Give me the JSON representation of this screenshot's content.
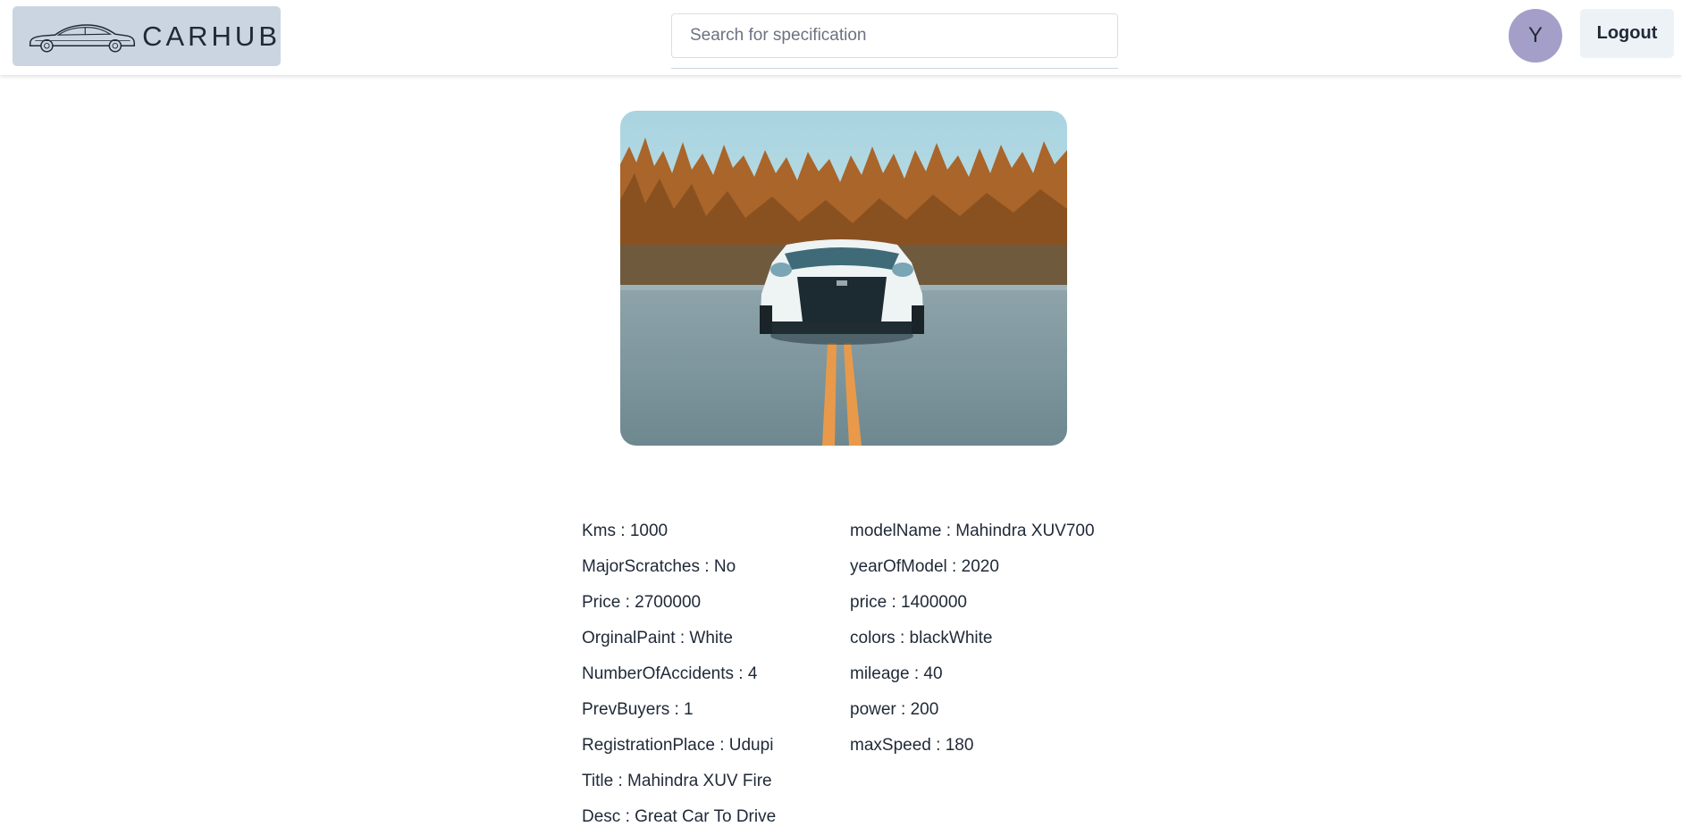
{
  "header": {
    "logo_text": "CARHUB",
    "search_placeholder": "Search for specification",
    "avatar_letter": "Y",
    "logout_label": "Logout"
  },
  "main": {
    "car_image_icon": "car-photo-image",
    "left_specs": [
      {
        "key": "Kms",
        "value": "1000"
      },
      {
        "key": "MajorScratches",
        "value": "No"
      },
      {
        "key": "Price",
        "value": "2700000"
      },
      {
        "key": "OrginalPaint",
        "value": "White"
      },
      {
        "key": "NumberOfAccidents",
        "value": "4"
      },
      {
        "key": "PrevBuyers",
        "value": "1"
      },
      {
        "key": "RegistrationPlace",
        "value": "Udupi"
      },
      {
        "key": "Title",
        "value": "Mahindra XUV Fire"
      },
      {
        "key": "Desc",
        "value": "Great Car To Drive"
      }
    ],
    "right_specs": [
      {
        "key": "modelName",
        "value": "Mahindra XUV700"
      },
      {
        "key": "yearOfModel",
        "value": "2020"
      },
      {
        "key": "price",
        "value": "1400000"
      },
      {
        "key": "colors",
        "value": "blackWhite"
      },
      {
        "key": "mileage",
        "value": "40"
      },
      {
        "key": "power",
        "value": "200"
      },
      {
        "key": "maxSpeed",
        "value": "180"
      }
    ]
  },
  "colors": {
    "logo_bg": "#cbd5e1",
    "avatar_bg": "#a39fc9",
    "logout_bg": "#edf2f7",
    "text": "#1f2937"
  }
}
